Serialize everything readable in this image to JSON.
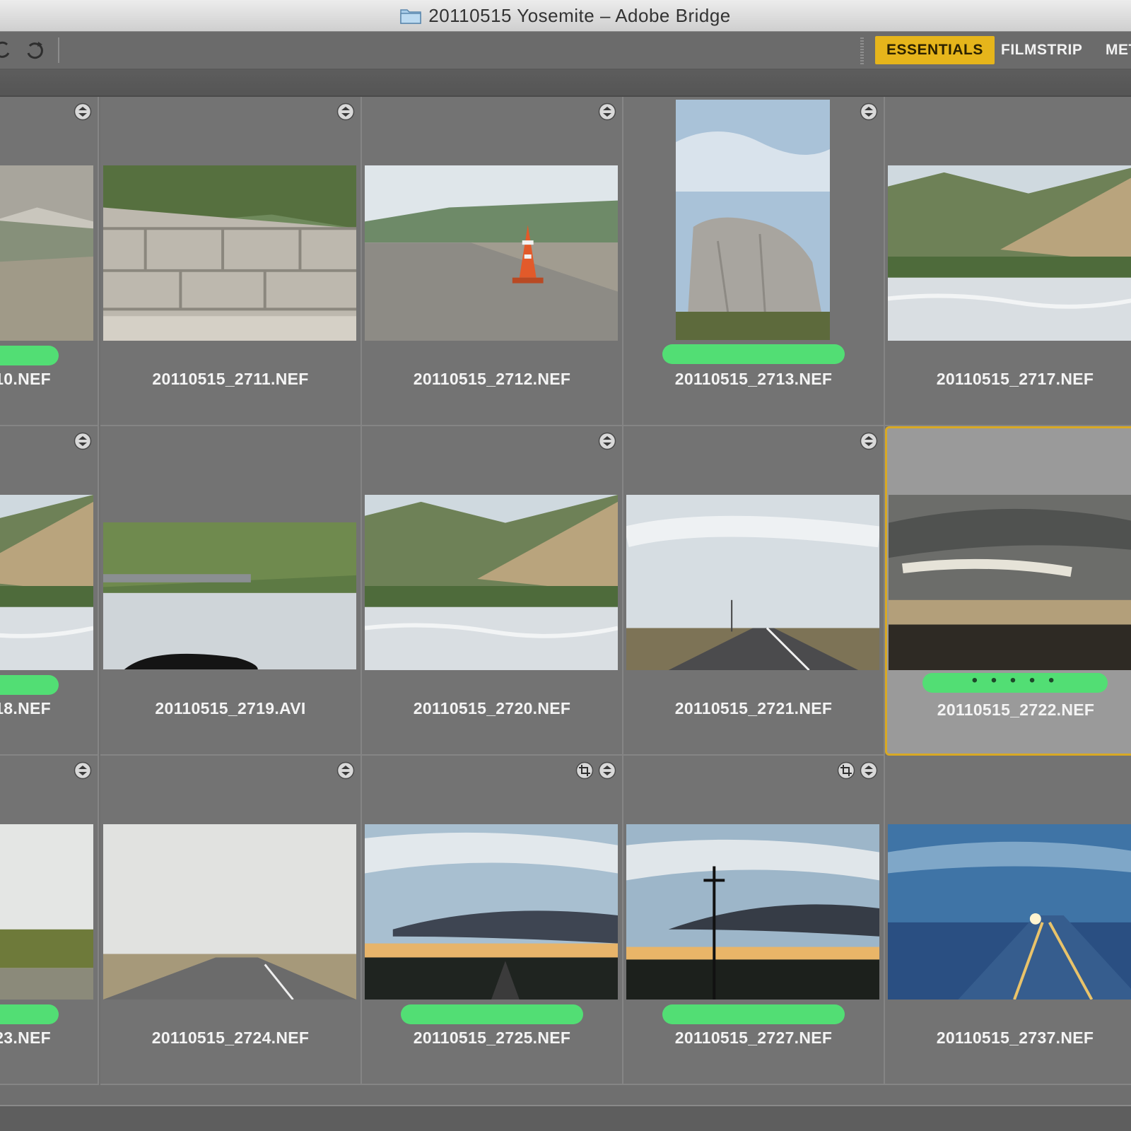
{
  "window": {
    "title": "20110515 Yosemite – Adobe Bridge"
  },
  "toolbar": {
    "icons": [
      "rotate-ccw-icon",
      "rotate-cw-icon"
    ],
    "workspaces": [
      {
        "label": "ESSENTIALS",
        "active": true
      },
      {
        "label": "FILMSTRIP",
        "active": false
      },
      {
        "label": "MET",
        "active": false
      }
    ]
  },
  "colors": {
    "accent": "#e6b51b",
    "label_green": "#52de74",
    "selection_border": "#d8a925"
  },
  "thumbnails": [
    {
      "name": "10.NEF",
      "label": true,
      "stack": true,
      "crop": false,
      "scene": "cliff-valley",
      "selected": false,
      "rating_dots": ""
    },
    {
      "name": "20110515_2711.NEF",
      "label": false,
      "stack": true,
      "crop": false,
      "scene": "stone-wall",
      "selected": false,
      "rating_dots": ""
    },
    {
      "name": "20110515_2712.NEF",
      "label": false,
      "stack": true,
      "crop": false,
      "scene": "road-cone",
      "selected": false,
      "rating_dots": ""
    },
    {
      "name": "20110515_2713.NEF",
      "label": true,
      "stack": true,
      "crop": false,
      "scene": "el-capitan",
      "selected": false,
      "rating_dots": ""
    },
    {
      "name": "20110515_2717.NEF",
      "label": false,
      "stack": false,
      "crop": false,
      "scene": "river-hill",
      "selected": false,
      "rating_dots": ""
    },
    {
      "name": "18.NEF",
      "label": true,
      "stack": true,
      "crop": false,
      "scene": "river-hill",
      "selected": false,
      "rating_dots": ""
    },
    {
      "name": "20110515_2719.AVI",
      "label": false,
      "stack": false,
      "crop": false,
      "scene": "river-bridge",
      "selected": false,
      "rating_dots": ""
    },
    {
      "name": "20110515_2720.NEF",
      "label": false,
      "stack": true,
      "crop": false,
      "scene": "river-hill",
      "selected": false,
      "rating_dots": ""
    },
    {
      "name": "20110515_2721.NEF",
      "label": false,
      "stack": true,
      "crop": false,
      "scene": "highway-day",
      "selected": false,
      "rating_dots": ""
    },
    {
      "name": "20110515_2722.NEF",
      "label": true,
      "stack": false,
      "crop": false,
      "scene": "storm-sky",
      "selected": true,
      "rating_dots": "• • • • •"
    },
    {
      "name": "23.NEF",
      "label": true,
      "stack": true,
      "crop": false,
      "scene": "field",
      "selected": false,
      "rating_dots": ""
    },
    {
      "name": "20110515_2724.NEF",
      "label": false,
      "stack": true,
      "crop": false,
      "scene": "highway-haze",
      "selected": false,
      "rating_dots": ""
    },
    {
      "name": "20110515_2725.NEF",
      "label": true,
      "stack": true,
      "crop": true,
      "scene": "sunset",
      "selected": false,
      "rating_dots": ""
    },
    {
      "name": "20110515_2727.NEF",
      "label": true,
      "stack": true,
      "crop": true,
      "scene": "sunset-pole",
      "selected": false,
      "rating_dots": ""
    },
    {
      "name": "20110515_2737.NEF",
      "label": false,
      "stack": false,
      "crop": false,
      "scene": "night-blue",
      "selected": false,
      "rating_dots": ""
    }
  ]
}
